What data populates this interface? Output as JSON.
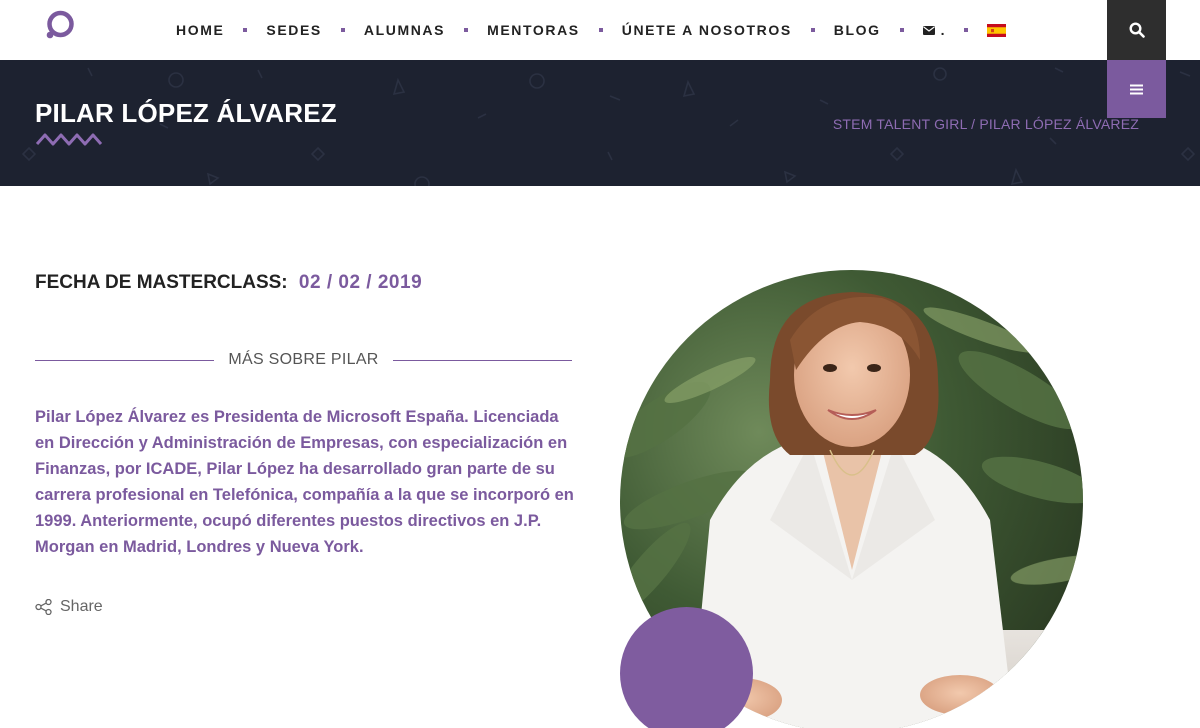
{
  "brand": {
    "logo_icon": "logo-ring-icon",
    "accent": "#7b5a9e",
    "dark": "#1d2230"
  },
  "nav": {
    "items": [
      {
        "label": "HOME"
      },
      {
        "label": "SEDES"
      },
      {
        "label": "ALUMNAS"
      },
      {
        "label": "MENTORAS"
      },
      {
        "label": "ÚNETE A NOSOTROS"
      },
      {
        "label": "BLOG"
      }
    ],
    "mail_icon": "envelope-icon",
    "mail_suffix": ".",
    "language_icon": "spain-flag-icon",
    "search_icon": "search-icon",
    "menu_icon": "hamburger-menu-icon"
  },
  "hero": {
    "title": "PILAR LÓPEZ ÁLVAREZ",
    "breadcrumb": {
      "home": "STEM TALENT GIRL",
      "separator": "/",
      "current": "PILAR LÓPEZ ÁLVAREZ"
    }
  },
  "content": {
    "date_label": "FECHA DE MASTERCLASS:",
    "date_value": "02 / 02 / 2019",
    "section_title": "MÁS SOBRE PILAR",
    "bio": "Pilar López Álvarez es Presidenta de Microsoft España. Licenciada en Dirección y Administración de Empresas, con especialización en Finanzas, por ICADE, Pilar López ha desarrollado gran parte de su carrera profesional en Telefónica, compañía a la que se incorporó en 1999. Anteriormente, ocupó diferentes puestos directivos en J.P. Morgan en Madrid, Londres y Nueva York.",
    "share_label": "Share",
    "share_icon": "share-icon"
  }
}
